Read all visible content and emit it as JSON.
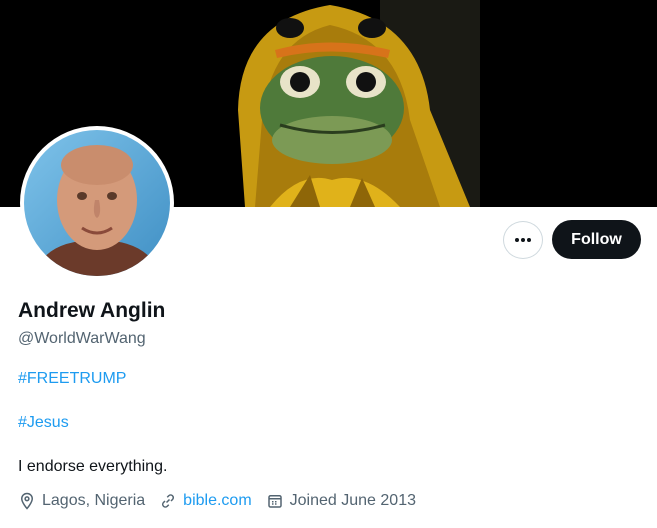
{
  "profile": {
    "name": "Andrew Anglin",
    "handle": "@WorldWarWang",
    "bio_lines": [
      "#FREETRUMP",
      "#Jesus",
      "I endorse everything."
    ],
    "location": "Lagos, Nigeria",
    "website": "bible.com",
    "joined": "Joined June 2013"
  },
  "actions": {
    "more_label": "•••",
    "follow_label": "Follow"
  },
  "icons": {
    "more": "more-horizontal-icon",
    "location": "location-pin-icon",
    "website": "link-icon",
    "joined": "calendar-icon"
  },
  "colors": {
    "link": "#1d9bf0",
    "text": "#0f1419",
    "secondary": "#536471",
    "follow_bg": "#0f1419",
    "follow_text": "#ffffff"
  }
}
